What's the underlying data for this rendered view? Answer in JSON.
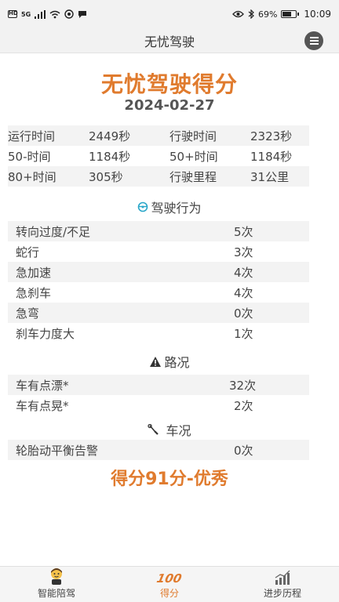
{
  "status": {
    "left_box": "HD",
    "network": "5G",
    "battery": "69%",
    "time": "10:09"
  },
  "header": {
    "title": "无忧驾驶"
  },
  "score": {
    "title": "无忧驾驶得分",
    "date": "2024-02-27"
  },
  "stats": [
    [
      "运行时间",
      "2449秒",
      "行驶时间",
      "2323秒"
    ],
    [
      "50-时间",
      "1184秒",
      "50+时间",
      "1184秒"
    ],
    [
      "80+时间",
      "305秒",
      "行驶里程",
      "31公里"
    ]
  ],
  "sections": {
    "behavior": {
      "heading": "驾驶行为",
      "items": [
        {
          "name": "转向过度/不足",
          "value": "5次"
        },
        {
          "name": "蛇行",
          "value": "3次"
        },
        {
          "name": "急加速",
          "value": "4次"
        },
        {
          "name": "急刹车",
          "value": "4次"
        },
        {
          "name": "急弯",
          "value": "0次"
        },
        {
          "name": "刹车力度大",
          "value": "1次"
        }
      ]
    },
    "road": {
      "heading": "路况",
      "items": [
        {
          "name": "车有点漂*",
          "value": "32次"
        },
        {
          "name": "车有点晃*",
          "value": "2次"
        }
      ]
    },
    "vehicle": {
      "heading": "车况",
      "items": [
        {
          "name": "轮胎动平衡告警",
          "value": "0次"
        }
      ]
    }
  },
  "final_score": "得分91分-优秀",
  "tabs": [
    {
      "label": "智能陪驾",
      "icon": "mascot-icon",
      "active": false
    },
    {
      "label": "得分",
      "icon": "score-100-icon",
      "glyph": "100",
      "active": true
    },
    {
      "label": "进步历程",
      "icon": "progress-chart-icon",
      "active": false
    }
  ],
  "colors": {
    "accent": "#e07b2e",
    "stripe": "#f3f3f3",
    "bar": "#f2f2f2"
  }
}
